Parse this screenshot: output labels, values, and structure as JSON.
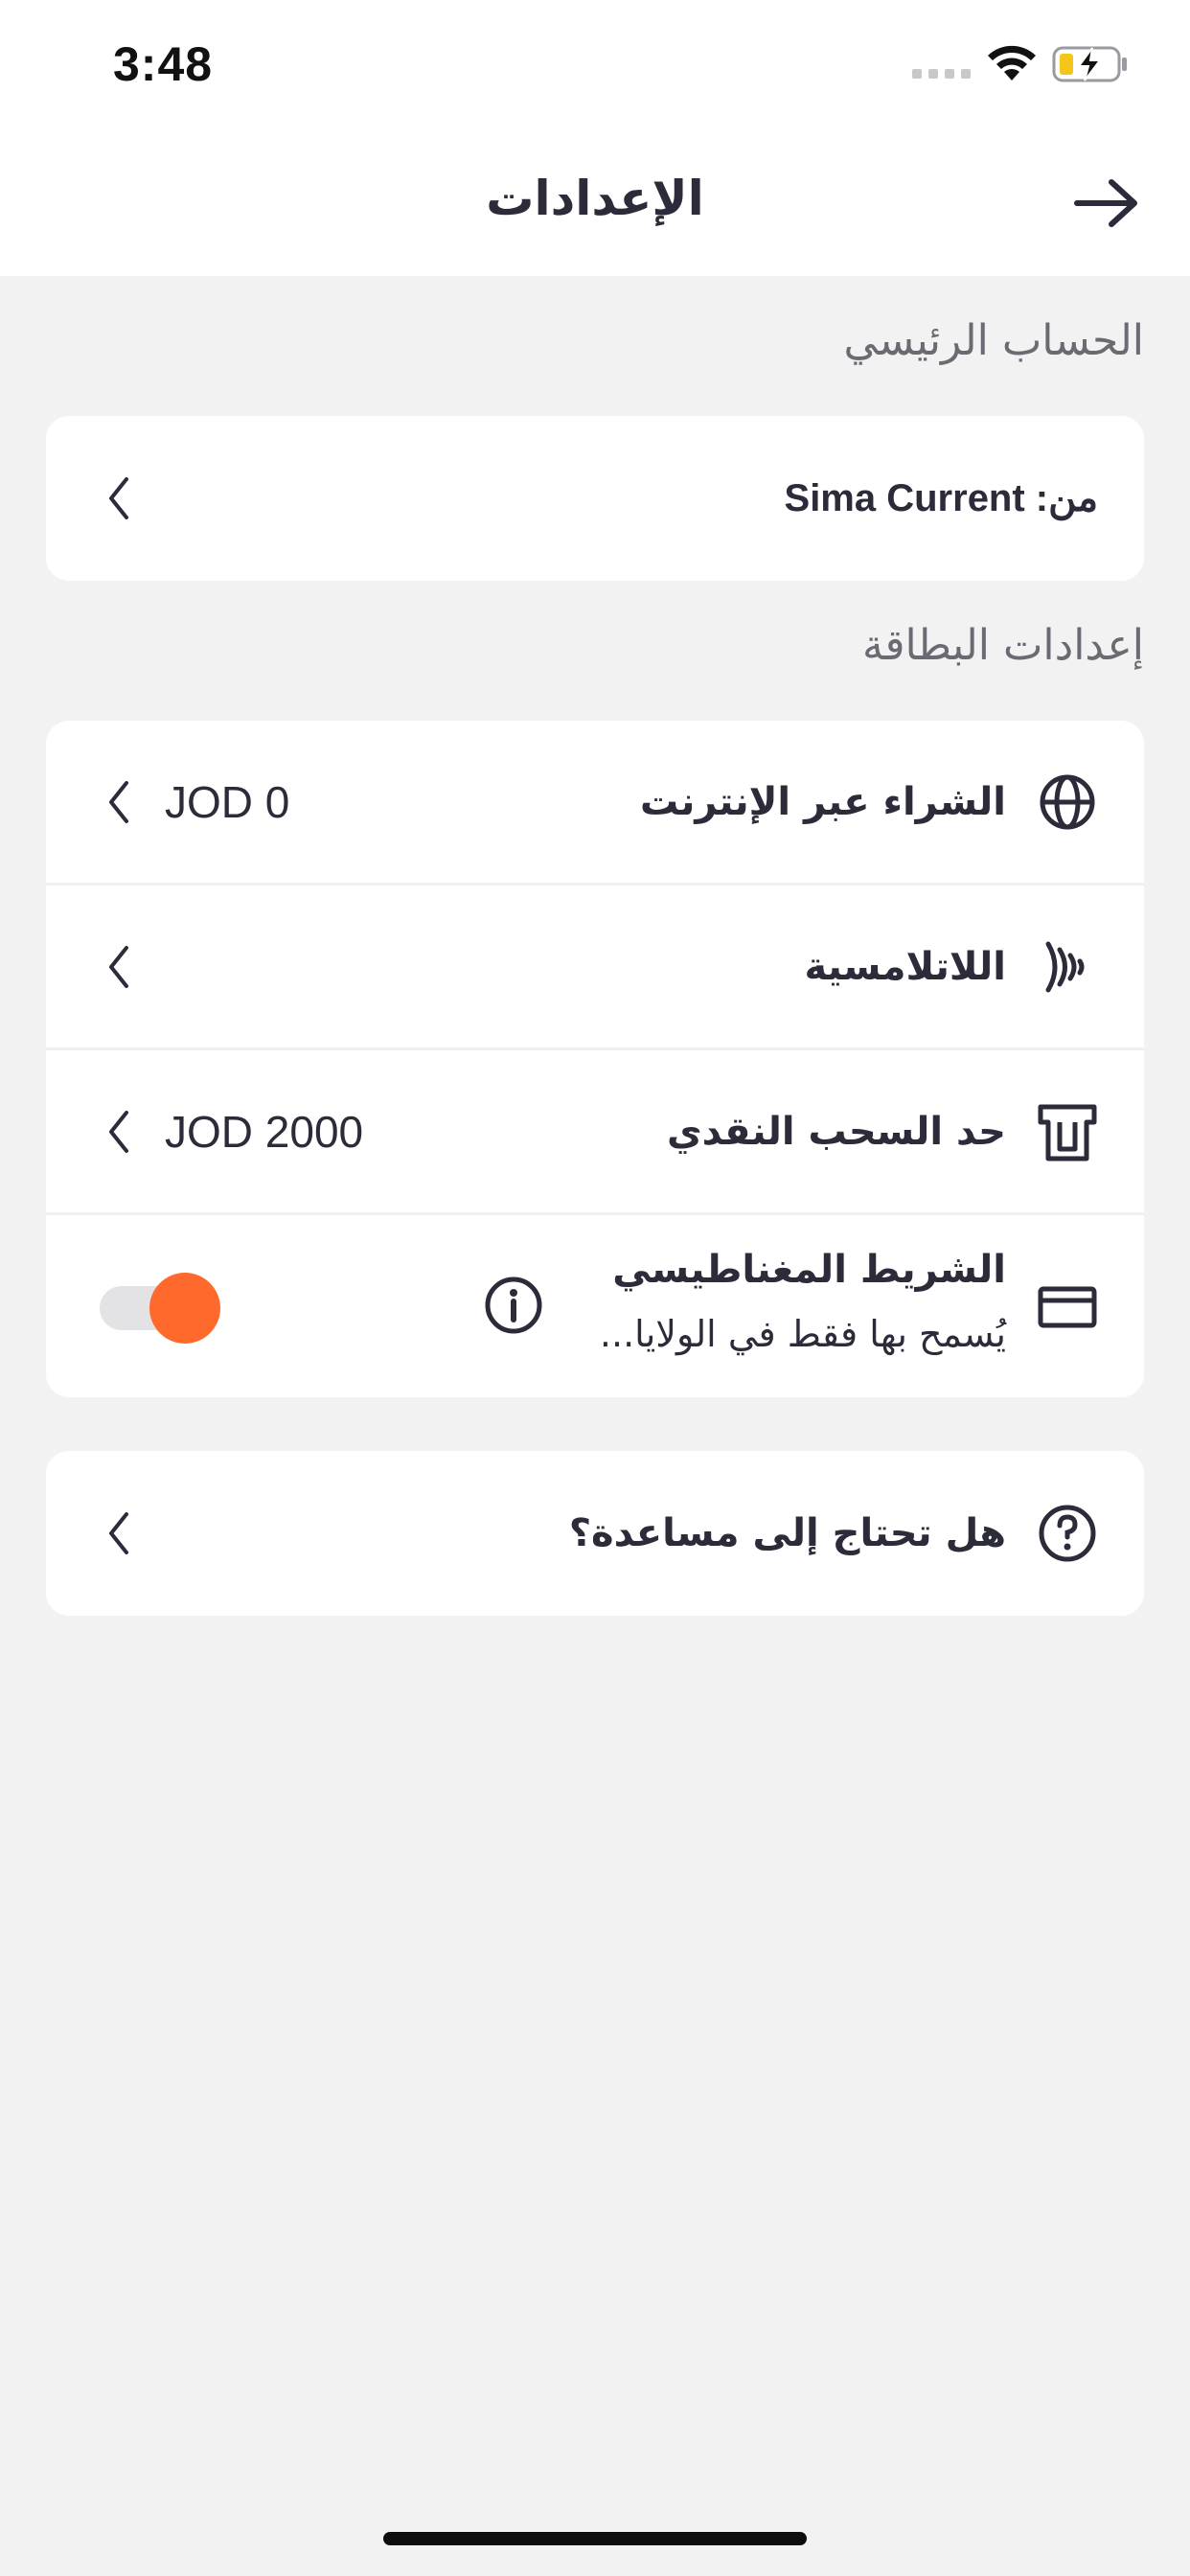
{
  "status_bar": {
    "time": "3:48"
  },
  "header": {
    "title": "الإعدادات"
  },
  "main_account": {
    "section_label": "الحساب الرئيسي",
    "from_label": "من: Sima Current"
  },
  "card_settings": {
    "section_label": "إعدادات البطاقة",
    "items": [
      {
        "label": "الشراء عبر الإنترنت",
        "value": "JOD 0",
        "icon": "globe-icon"
      },
      {
        "label": "اللاتلامسية",
        "value": "",
        "icon": "contactless-icon"
      },
      {
        "label": "حد السحب النقدي",
        "value": "JOD 2000",
        "icon": "atm-icon"
      }
    ],
    "magnetic_stripe": {
      "title": "الشريط المغناطيسي",
      "subtitle": "يُسمح بها فقط في الولايا...",
      "enabled": true,
      "icon": "card-icon"
    }
  },
  "help": {
    "label": "هل تحتاج إلى مساعدة؟",
    "icon": "question-icon"
  },
  "colors": {
    "accent": "#ff6a2c",
    "background": "#f2f2f2",
    "text": "#2b2b3a"
  }
}
